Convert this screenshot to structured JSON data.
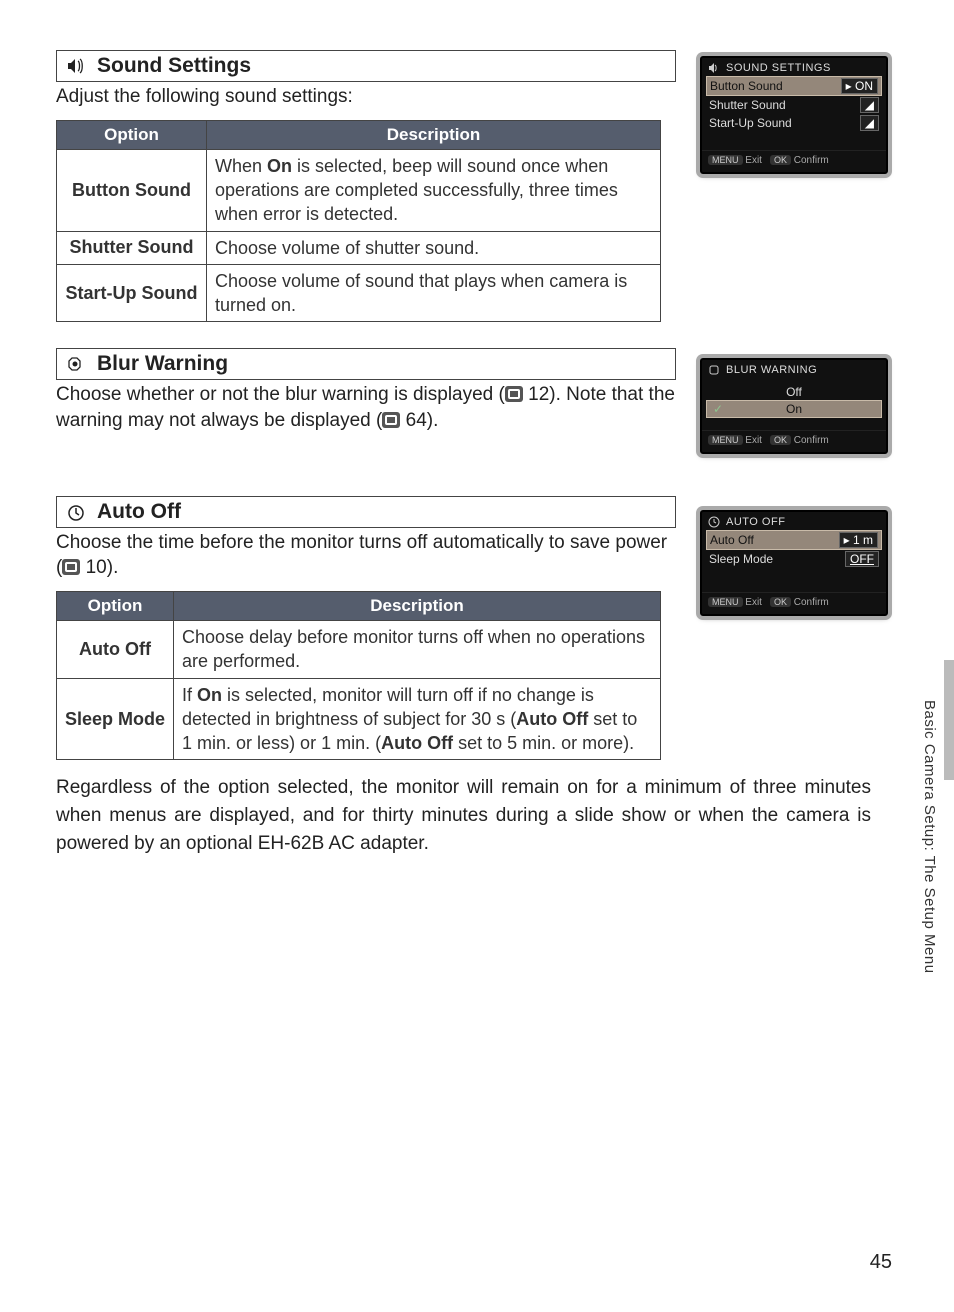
{
  "sections": {
    "sound": {
      "heading": "Sound Settings",
      "intro": "Adjust the following sound settings:",
      "table": {
        "headers": {
          "option": "Option",
          "description": "Description"
        },
        "rows": [
          {
            "option": "Button Sound",
            "desc_pre": "When ",
            "desc_bold1": "On",
            "desc_post": " is selected, beep will sound once when operations are completed successfully, three times when error is detected."
          },
          {
            "option": "Shutter Sound",
            "desc": "Choose volume of shutter sound."
          },
          {
            "option": "Start-Up Sound",
            "desc": "Choose volume of sound that plays when camera is turned on."
          }
        ]
      }
    },
    "blur": {
      "heading": "Blur Warning",
      "text_line1_a": "Choose whether or not the blur warning is displayed (",
      "text_line1_b": " 12).",
      "text_line2_a": "Note that the warning may not always be displayed (",
      "text_line2_b": " 64)."
    },
    "autooff": {
      "heading": "Auto Off",
      "intro_a": "Choose the time before the monitor turns off automatically to save power (",
      "intro_b": " 10).",
      "table": {
        "headers": {
          "option": "Option",
          "description": "Description"
        },
        "rows": [
          {
            "option": "Auto Off",
            "desc": "Choose delay before monitor turns off when no operations are performed."
          },
          {
            "option": "Sleep Mode",
            "desc_a": "If ",
            "desc_b1": "On",
            "desc_c": " is selected, monitor will turn off if no change is detected in brightness of subject for 30 s (",
            "desc_b2": "Auto Off",
            "desc_d": " set to 1 min. or less) or 1 min. (",
            "desc_b3": "Auto Off",
            "desc_e": " set to 5 min. or more)."
          }
        ]
      },
      "below": "Regardless of the option selected, the monitor will remain on for a minimum of three minutes when menus are displayed, and for thirty minutes during a slide show or when the camera is powered by an optional EH-62B AC adapter."
    }
  },
  "lcds": {
    "sound": {
      "title": "SOUND SETTINGS",
      "rows": [
        {
          "label": "Button Sound",
          "value": "ON",
          "selected": true
        },
        {
          "label": "Shutter Sound",
          "value": "◢"
        },
        {
          "label": "Start-Up Sound",
          "value": "◢"
        }
      ],
      "footer": {
        "exit": "Exit",
        "confirm": "Confirm",
        "menu": "MENU",
        "ok": "OK"
      }
    },
    "blur": {
      "title": "BLUR WARNING",
      "options": {
        "off": "Off",
        "on": "On"
      },
      "footer": {
        "exit": "Exit",
        "confirm": "Confirm",
        "menu": "MENU",
        "ok": "OK"
      }
    },
    "autooff": {
      "title": "AUTO OFF",
      "rows": [
        {
          "label": "Auto Off",
          "value": "1 m",
          "selected": true
        },
        {
          "label": "Sleep Mode",
          "value": "OFF"
        }
      ],
      "footer": {
        "exit": "Exit",
        "confirm": "Confirm",
        "menu": "MENU",
        "ok": "OK"
      }
    }
  },
  "sidebar_label": "Basic Camera Setup: The Setup Menu",
  "page_number": "45"
}
